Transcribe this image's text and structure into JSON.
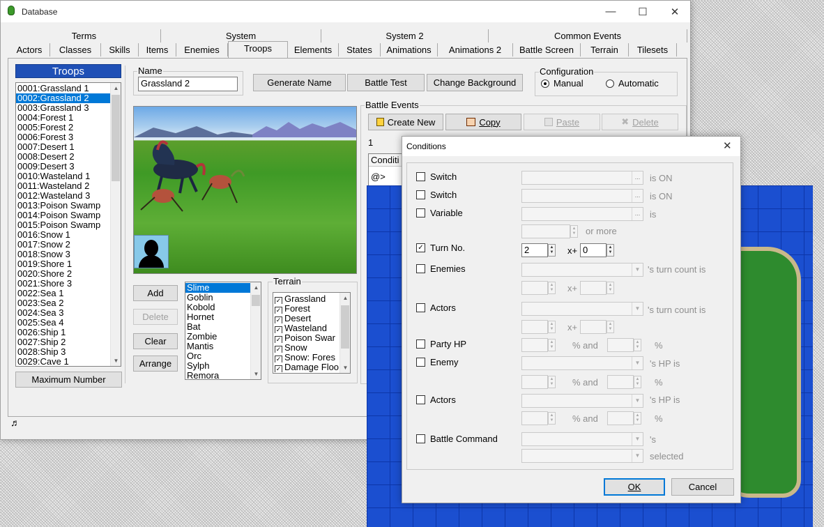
{
  "database": {
    "title": "Database",
    "tabs_top": [
      "Terms",
      "System",
      "System 2",
      "Common Events"
    ],
    "tabs_bottom": [
      "Actors",
      "Classes",
      "Skills",
      "Items",
      "Enemies",
      "Troops",
      "Elements",
      "States",
      "Animations",
      "Animations 2",
      "Battle Screen",
      "Terrain",
      "Tilesets"
    ],
    "active_tab": "Troops",
    "troops_header": "Troops",
    "troops": [
      "0001:Grassland 1",
      "0002:Grassland 2",
      "0003:Grassland 3",
      "0004:Forest 1",
      "0005:Forest 2",
      "0006:Forest 3",
      "0007:Desert 1",
      "0008:Desert 2",
      "0009:Desert 3",
      "0010:Wasteland 1",
      "0011:Wasteland 2",
      "0012:Wasteland 3",
      "0013:Poison Swamp",
      "0014:Poison Swamp",
      "0015:Poison Swamp",
      "0016:Snow 1",
      "0017:Snow 2",
      "0018:Snow 3",
      "0019:Shore 1",
      "0020:Shore 2",
      "0021:Shore 3",
      "0022:Sea 1",
      "0023:Sea 2",
      "0024:Sea 3",
      "0025:Sea 4",
      "0026:Ship 1",
      "0027:Ship 2",
      "0028:Ship 3",
      "0029:Cave 1"
    ],
    "max_number": "Maximum Number",
    "name_label": "Name",
    "name_value": "Grassland 2",
    "generate_name": "Generate Name",
    "battle_test": "Battle Test",
    "change_background": "Change Background",
    "configuration": {
      "label": "Configuration",
      "manual": "Manual",
      "automatic": "Automatic"
    },
    "add": "Add",
    "delete": "Delete",
    "clear": "Clear",
    "arrange": "Arrange",
    "enemies": [
      "Slime",
      "Goblin",
      "Kobold",
      "Hornet",
      "Bat",
      "Zombie",
      "Mantis",
      "Orc",
      "Sylph",
      "Remora"
    ],
    "terrain_label": "Terrain",
    "terrain": [
      "Grassland",
      "Forest",
      "Desert",
      "Wasteland",
      "Poison Swar",
      "Snow",
      "Snow: Fores",
      "Damage Floo"
    ],
    "battle_events": {
      "label": "Battle Events",
      "create_new": "Create New",
      "copy": "Copy",
      "paste": "Paste",
      "delete": "Delete",
      "page": "1",
      "conditions_header": "Conditi",
      "event_line": "@>"
    }
  },
  "conditions": {
    "title": "Conditions",
    "rows": {
      "switch1": "Switch",
      "switch2": "Switch",
      "variable": "Variable",
      "turn": "Turn No.",
      "enemies": "Enemies",
      "actors1": "Actors",
      "party_hp": "Party HP",
      "enemy": "Enemy",
      "actors2": "Actors",
      "battle_command": "Battle Command"
    },
    "suffix": {
      "is_on": "is ON",
      "is": "is",
      "or_more": "or more",
      "xplus": "x+",
      "turn_count": "'s turn count is",
      "percent_and": "% and",
      "percent": "%",
      "hp_is": "'s HP is",
      "s": "'s",
      "selected": "selected"
    },
    "turn_a": "2",
    "turn_b": "0",
    "ok": "OK",
    "cancel": "Cancel"
  }
}
